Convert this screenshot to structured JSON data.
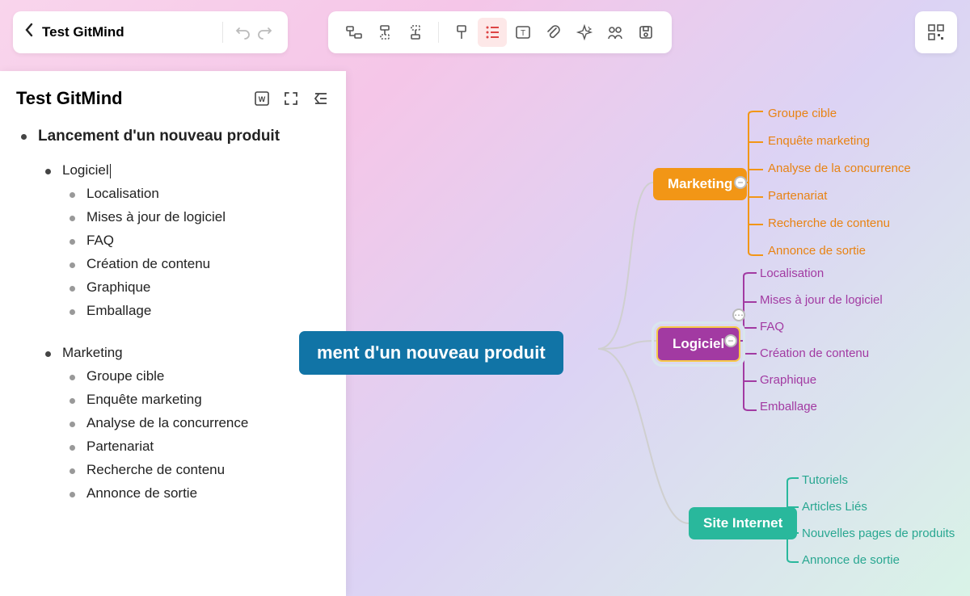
{
  "header": {
    "doc_title": "Test GitMind"
  },
  "outline": {
    "title": "Test GitMind",
    "root": "Lancement d'un nouveau produit",
    "groups": [
      {
        "label": "Logiciel",
        "editing": true,
        "items": [
          "Localisation",
          "Mises à jour de logiciel",
          "FAQ",
          "Création de contenu",
          "Graphique",
          "Emballage"
        ]
      },
      {
        "label": "Marketing",
        "editing": false,
        "items": [
          "Groupe cible",
          "Enquête marketing",
          "Analyse de la concurrence",
          "Partenariat",
          "Recherche de contenu",
          "Annonce de sortie"
        ]
      }
    ]
  },
  "mindmap": {
    "root": "ment d'un nouveau produit",
    "branches": {
      "marketing": {
        "label": "Marketing",
        "color": "#f29616",
        "leaves": [
          "Groupe cible",
          "Enquête marketing",
          "Analyse de la concurrence",
          "Partenariat",
          "Recherche de contenu",
          "Annonce de sortie"
        ]
      },
      "logiciel": {
        "label": "Logiciel",
        "color": "#a23aa2",
        "leaves": [
          "Localisation",
          "Mises à jour de logiciel",
          "FAQ",
          "Création de contenu",
          "Graphique",
          "Emballage"
        ]
      },
      "site": {
        "label": "Site Internet",
        "color": "#29b89c",
        "leaves": [
          "Tutoriels",
          "Articles Liés",
          "Nouvelles pages de produits",
          "Annonce de sortie"
        ]
      }
    }
  },
  "toolbar": {
    "icons": [
      "subtopic-icon",
      "topic-before-icon",
      "topic-after-icon",
      "format-icon",
      "outline-icon",
      "text-icon",
      "attachment-icon",
      "ai-icon",
      "share-icon",
      "save-icon",
      "qr-icon"
    ]
  }
}
